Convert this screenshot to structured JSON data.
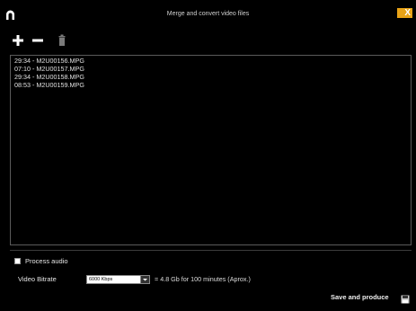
{
  "window": {
    "title": "Merge and convert video files",
    "close_label": "X",
    "logo_icon": "app-logo-icon",
    "accent_color": "#e8a317"
  },
  "toolbar": {
    "add_icon": "plus-icon",
    "remove_icon": "minus-icon",
    "delete_icon": "trash-icon"
  },
  "files": [
    "29:34 - M2U00156.MPG",
    "07:10 - M2U00157.MPG",
    "29:34 - M2U00158.MPG",
    "08:53 - M2U00159.MPG"
  ],
  "options": {
    "process_audio_label": "Process audio",
    "process_audio_checked": false,
    "bitrate_label": "Video Bitrate",
    "bitrate_value": "6000 Kbps",
    "size_estimate": "= 4.8 Gb for 100 minutes (Aprox.)"
  },
  "actions": {
    "save_produce_label": "Save and produce",
    "save_icon": "floppy-disk-icon"
  }
}
